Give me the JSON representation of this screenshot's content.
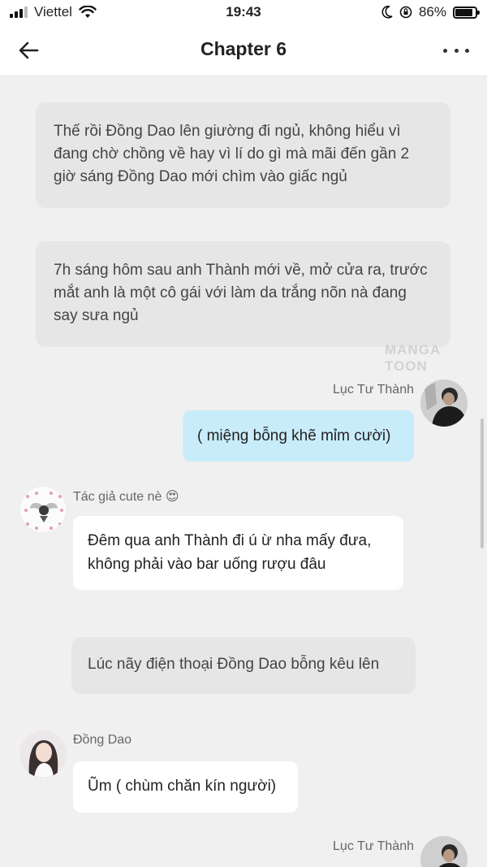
{
  "status_bar": {
    "carrier": "Viettel",
    "time": "19:43",
    "battery_percent": "86%",
    "battery_level": 0.86,
    "icons": [
      "signal-icon",
      "wifi-icon",
      "moon-icon",
      "rotation-lock-icon",
      "battery-icon"
    ]
  },
  "nav": {
    "title": "Chapter 6",
    "back_icon": "back-arrow-icon",
    "more_icon": "more-icon"
  },
  "watermark": "MANGA TOON",
  "messages": {
    "narration_1": "Thế rồi Đồng Dao lên giường đi ngủ, không hiểu vì đang chờ chồng về hay vì lí do gì mà mãi đến gần 2 giờ sáng Đồng Dao mới chìm vào giấc ngủ",
    "narration_2": "7h sáng hôm sau anh Thành mới về, mở cửa ra, trước mắt anh là một cô gái với làm da trắng nõn nà đang say sưa ngủ",
    "msg_luc_1_name": "Lục Tư Thành",
    "msg_luc_1_text": "( miệng bỗng khẽ mỉm cười)",
    "msg_author_name": "Tác giả cute nè 😍",
    "msg_author_text": "Đêm qua anh Thành đi ú ừ nha mấy đưa, không phải vào bar uống rượu đâu",
    "narration_3": "Lúc nãy điện thoại Đồng Dao bỗng kêu lên",
    "msg_dong_name": "Đồng Dao",
    "msg_dong_text": "Ũm ( chùm chăn kín người)",
    "msg_luc_2_name": "Lục Tư Thành"
  },
  "colors": {
    "background": "#f0f0f0",
    "narration_bg": "#e6e6e6",
    "self_bubble": "#c9ecfa",
    "other_bubble": "#ffffff"
  }
}
